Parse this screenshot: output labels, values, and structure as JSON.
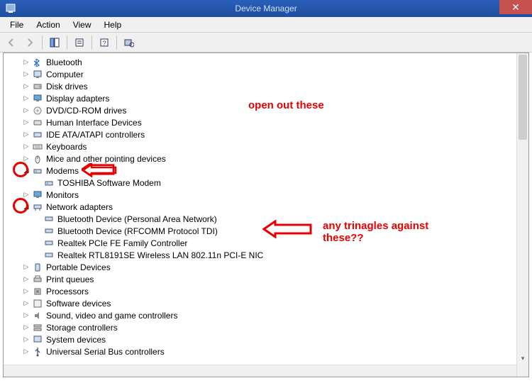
{
  "window": {
    "title": "Device Manager"
  },
  "menu": {
    "file": "File",
    "action": "Action",
    "view": "View",
    "help": "Help"
  },
  "annotations": {
    "open_out": "open out these",
    "triangles": "any trinagles against these??"
  },
  "tree": {
    "bluetooth": "Bluetooth",
    "computer": "Computer",
    "disk_drives": "Disk drives",
    "display_adapters": "Display adapters",
    "dvd": "DVD/CD-ROM drives",
    "hid": "Human Interface Devices",
    "ide": "IDE ATA/ATAPI controllers",
    "keyboards": "Keyboards",
    "mice": "Mice and other pointing devices",
    "modems": "Modems",
    "modem_child": "TOSHIBA Software Modem",
    "monitors": "Monitors",
    "network": "Network adapters",
    "net_bt_pan": "Bluetooth Device (Personal Area Network)",
    "net_bt_rfc": "Bluetooth Device (RFCOMM Protocol TDI)",
    "net_realtek_fe": "Realtek PCIe FE Family Controller",
    "net_realtek_wlan": "Realtek RTL8191SE Wireless LAN 802.11n PCI-E NIC",
    "portable": "Portable Devices",
    "print_queues": "Print queues",
    "processors": "Processors",
    "software_devices": "Software devices",
    "sound": "Sound, video and game controllers",
    "storage": "Storage controllers",
    "system": "System devices",
    "usb": "Universal Serial Bus controllers"
  }
}
